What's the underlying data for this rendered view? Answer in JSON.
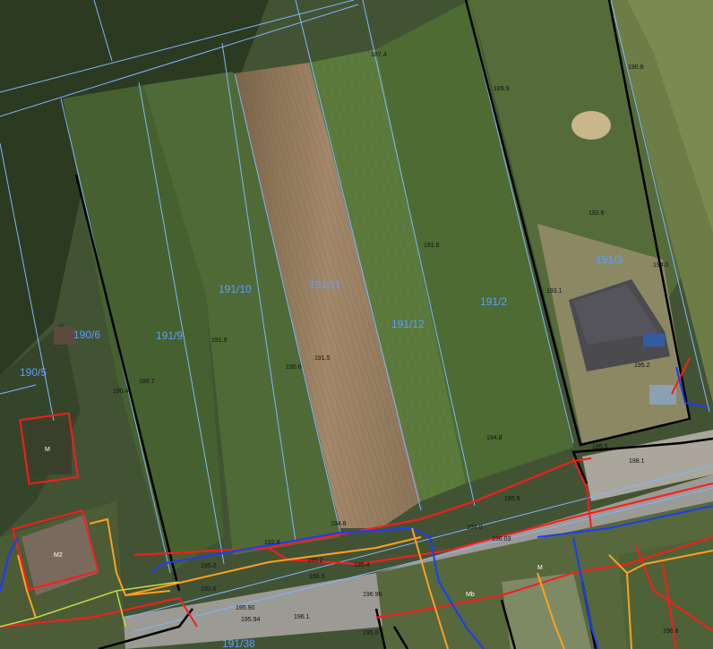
{
  "map": {
    "parcels": [
      {
        "label": "190/5"
      },
      {
        "label": "190/6"
      },
      {
        "label": "191/9"
      },
      {
        "label": "191/10"
      },
      {
        "label": "191/11"
      },
      {
        "label": "191/12"
      },
      {
        "label": "191/2"
      },
      {
        "label": "191/3"
      },
      {
        "label": "191/38"
      }
    ],
    "elevations": [
      "187.4",
      "189.9",
      "190.8",
      "192.6",
      "191.6",
      "193.1",
      "194.0",
      "191.9",
      "190.6",
      "191.5",
      "190.4",
      "189.7",
      "195.2",
      "194.8",
      "195.5",
      "198.1",
      "195.6",
      "194.8",
      "194.0",
      "196.03",
      "192.8",
      "195.0",
      "195.2",
      "193.6",
      "195.90",
      "195.94",
      "196.5",
      "195.4",
      "196.8",
      "196.1",
      "196.96",
      "195.6"
    ],
    "utility_colors": {
      "electric": "#ff1a1a",
      "water": "#1a3cff",
      "gas": "#ffa020",
      "telecom": "#2f8f2f",
      "building": "#000000",
      "parcel_boundary": "#7fb6ff"
    },
    "building_labels": [
      "M",
      "M2",
      "M",
      "Mb"
    ]
  }
}
